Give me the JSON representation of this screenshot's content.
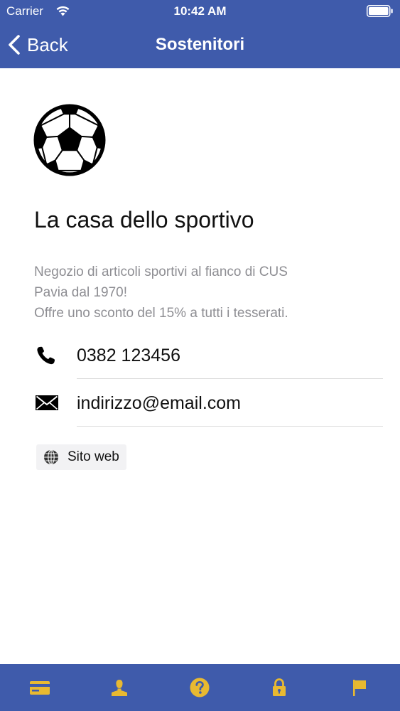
{
  "status_bar": {
    "carrier": "Carrier",
    "time": "10:42 AM"
  },
  "nav": {
    "back_label": "Back",
    "title": "Sostenitori"
  },
  "sponsor": {
    "icon": "soccer-ball-icon",
    "name": "La casa dello sportivo",
    "description_lines": [
      "Negozio di articoli sportivi al fianco di CUS",
      "Pavia dal 1970!",
      "Offre uno sconto del 15% a tutti i tesserati."
    ],
    "phone": "0382 123456",
    "email": "indirizzo@email.com",
    "website_label": "Sito web"
  },
  "tab_bar": {
    "items": [
      {
        "icon": "card-icon"
      },
      {
        "icon": "person-icon"
      },
      {
        "icon": "help-icon"
      },
      {
        "icon": "lock-icon"
      },
      {
        "icon": "flag-icon"
      }
    ]
  },
  "colors": {
    "bar_background": "#3f5bab",
    "tab_icon": "#e8b931",
    "secondary_text": "#8e8e93"
  }
}
